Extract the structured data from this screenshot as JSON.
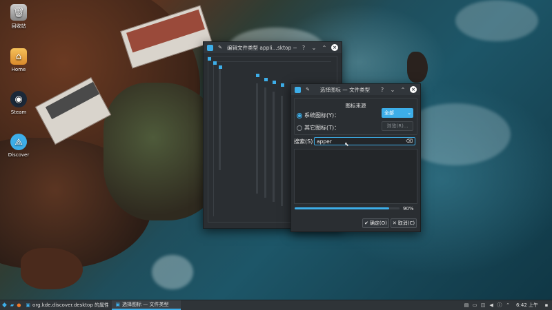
{
  "desktop": {
    "icons": [
      {
        "label": "回收站",
        "icon": "trash-icon"
      },
      {
        "label": "Home",
        "icon": "home-folder-icon"
      },
      {
        "label": "Steam",
        "icon": "steam-icon"
      },
      {
        "label": "Discover",
        "icon": "discover-icon"
      }
    ]
  },
  "back_window": {
    "title": "编辑文件类型 appli...sktop — 文件类型"
  },
  "dialog": {
    "title": "选择图标 — 文件类型",
    "group_title": "图标来源",
    "system_icons_label": "系统图标(Y)：",
    "other_icons_label": "其它图标(T)：",
    "category_value": "全部",
    "browse_label": "浏览(R)...",
    "search_label": "搜索(S)：",
    "search_value": "apper",
    "progress_percent": 90,
    "progress_text": "90%",
    "ok_label": "确定(O)",
    "cancel_label": "取消(C)"
  },
  "taskbar": {
    "tasks": [
      {
        "label": "org.kde.discover.desktop 的属性 ..."
      },
      {
        "label": "选择图标 — 文件类型"
      }
    ],
    "clock": "6:42 上午"
  },
  "colors": {
    "accent": "#3daee9",
    "window_bg": "#2a2e32",
    "titlebar_bg": "#31363b"
  }
}
